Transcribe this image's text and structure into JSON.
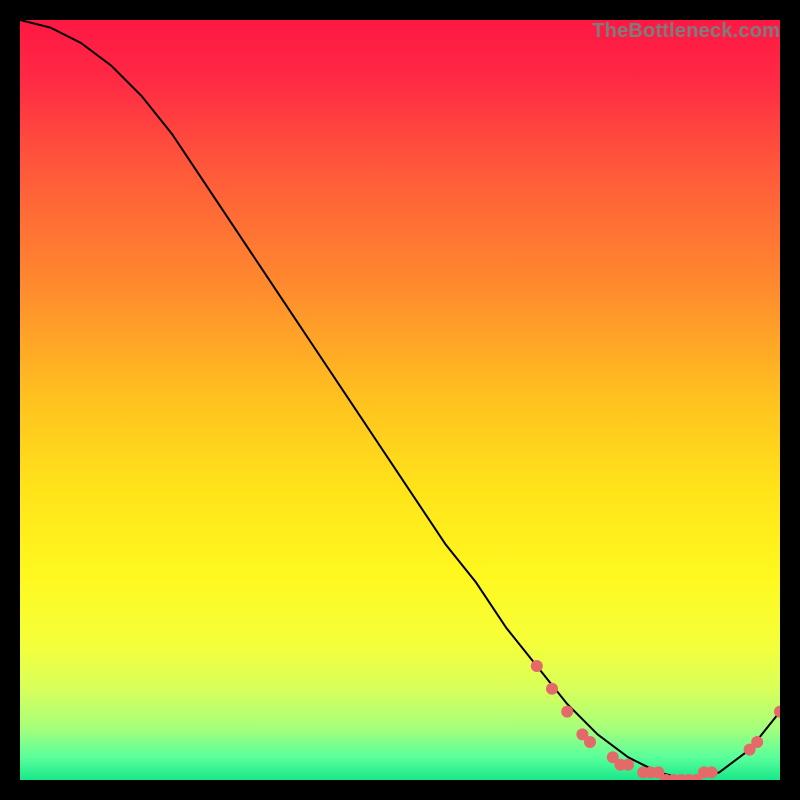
{
  "watermark": "TheBottleneck.com",
  "chart_data": {
    "type": "line",
    "title": "",
    "xlabel": "",
    "ylabel": "",
    "xlim": [
      0,
      100
    ],
    "ylim": [
      0,
      100
    ],
    "grid": false,
    "legend": false,
    "series": [
      {
        "name": "bottleneck-curve",
        "x": [
          0,
          4,
          8,
          12,
          16,
          20,
          24,
          28,
          32,
          36,
          40,
          44,
          48,
          52,
          56,
          60,
          64,
          68,
          72,
          76,
          80,
          84,
          88,
          92,
          96,
          100
        ],
        "y": [
          100,
          99,
          97,
          94,
          90,
          85,
          79,
          73,
          67,
          61,
          55,
          49,
          43,
          37,
          31,
          26,
          20,
          15,
          10,
          6,
          3,
          1,
          0,
          1,
          4,
          9
        ]
      }
    ],
    "highlight_points": [
      {
        "x": 68,
        "y": 15
      },
      {
        "x": 70,
        "y": 12
      },
      {
        "x": 72,
        "y": 9
      },
      {
        "x": 74,
        "y": 6
      },
      {
        "x": 75,
        "y": 5
      },
      {
        "x": 78,
        "y": 3
      },
      {
        "x": 79,
        "y": 2
      },
      {
        "x": 80,
        "y": 2
      },
      {
        "x": 82,
        "y": 1
      },
      {
        "x": 83,
        "y": 1
      },
      {
        "x": 84,
        "y": 1
      },
      {
        "x": 85,
        "y": 0
      },
      {
        "x": 86,
        "y": 0
      },
      {
        "x": 87,
        "y": 0
      },
      {
        "x": 88,
        "y": 0
      },
      {
        "x": 89,
        "y": 0
      },
      {
        "x": 90,
        "y": 1
      },
      {
        "x": 91,
        "y": 1
      },
      {
        "x": 96,
        "y": 4
      },
      {
        "x": 97,
        "y": 5
      },
      {
        "x": 100,
        "y": 9
      }
    ],
    "gradient_stops": [
      {
        "t": 0.0,
        "color": "#ff1744"
      },
      {
        "t": 0.08,
        "color": "#ff2a44"
      },
      {
        "t": 0.2,
        "color": "#ff5a3a"
      },
      {
        "t": 0.35,
        "color": "#ff8a2e"
      },
      {
        "t": 0.5,
        "color": "#ffc21f"
      },
      {
        "t": 0.62,
        "color": "#ffe41a"
      },
      {
        "t": 0.73,
        "color": "#fff81f"
      },
      {
        "t": 0.82,
        "color": "#f5ff3a"
      },
      {
        "t": 0.88,
        "color": "#d8ff5a"
      },
      {
        "t": 0.93,
        "color": "#a8ff7a"
      },
      {
        "t": 0.97,
        "color": "#5aff9a"
      },
      {
        "t": 1.0,
        "color": "#17e88a"
      }
    ],
    "marker_color": "#e46a6a",
    "line_color": "#000000"
  }
}
